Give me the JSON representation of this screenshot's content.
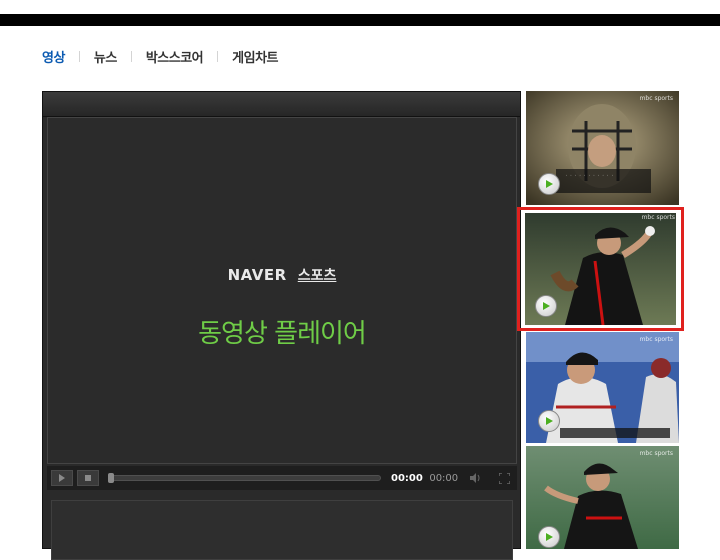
{
  "tabs": [
    {
      "label": "영상",
      "active": true
    },
    {
      "label": "뉴스",
      "active": false
    },
    {
      "label": "박스스코어",
      "active": false
    },
    {
      "label": "게임차트",
      "active": false
    }
  ],
  "player": {
    "brand_naver": "NAVER",
    "brand_sports": "스포츠",
    "brand_title": "동영상 플레이어",
    "current_time": "00:00",
    "duration": "00:00",
    "progress": 0
  },
  "thumbnails": [
    {
      "channel": "mbc sports",
      "selected": false
    },
    {
      "channel": "mbc sports",
      "selected": true
    },
    {
      "channel": "mbc sports",
      "selected": false
    },
    {
      "channel": "mbc sports",
      "selected": false
    }
  ],
  "colors": {
    "active_tab": "#0b5ab1",
    "player_title": "#6fcd47",
    "selection_border": "#e0211e",
    "play_icon": "#4caf21"
  }
}
